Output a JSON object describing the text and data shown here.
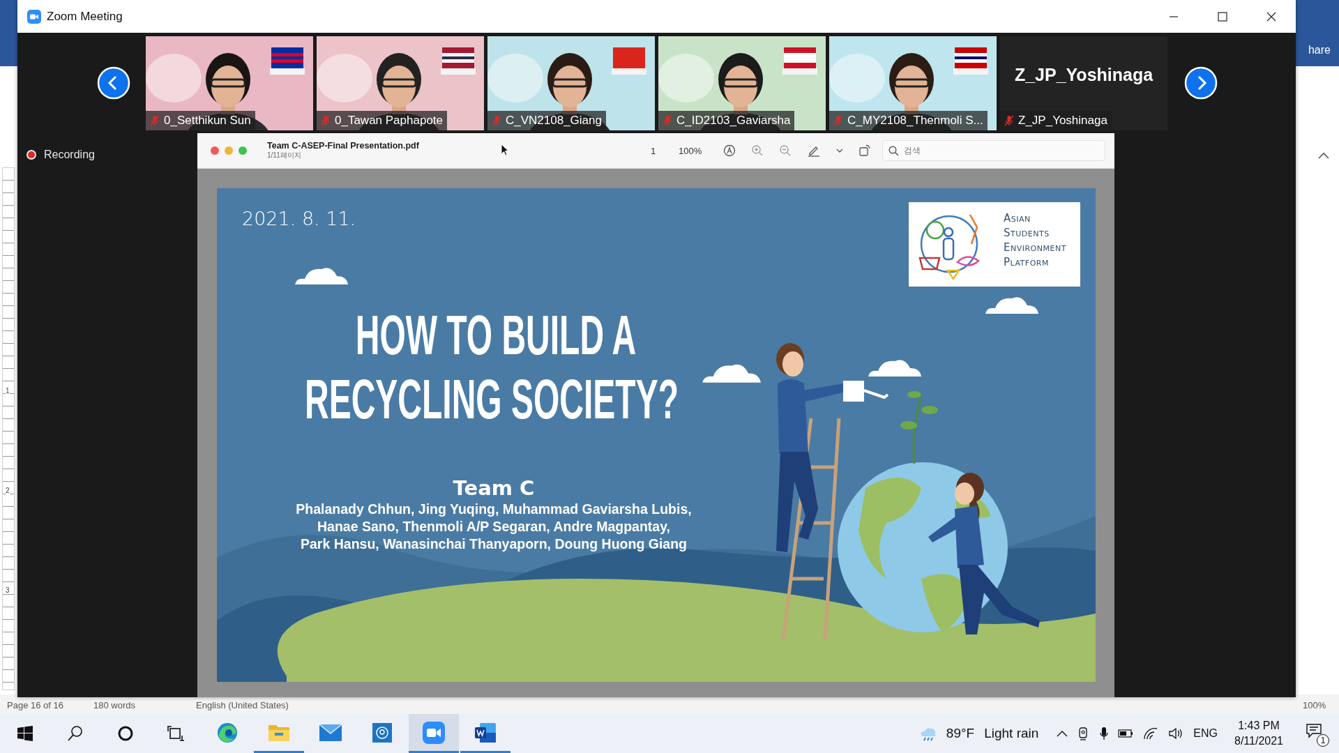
{
  "background_window": {
    "ribbon_text": "hare",
    "ruler_marks": [
      "1",
      "2",
      "3"
    ],
    "status_bar": [
      "Page 16 of 16",
      "180 words",
      "English (United States)",
      "100%"
    ]
  },
  "window": {
    "title": "Zoom Meeting"
  },
  "participants": [
    {
      "kind": "video",
      "name": "0_Setthikun Sun",
      "muted": true
    },
    {
      "kind": "video",
      "name": "0_Tawan Paphapote",
      "muted": true
    },
    {
      "kind": "video",
      "name": "C_VN2108_Giang",
      "muted": true
    },
    {
      "kind": "video",
      "name": "C_ID2103_Gaviarsha",
      "muted": true
    },
    {
      "kind": "video",
      "name": "C_MY2108_Thenmoli S...",
      "muted": true
    },
    {
      "kind": "name",
      "display_name": "Z_JP_Yoshinaga",
      "name": "Z_JP_Yoshinaga",
      "muted": true
    }
  ],
  "recording": {
    "label": "Recording"
  },
  "pdf_viewer": {
    "filename": "Team C-ASEP-Final Presentation.pdf",
    "pages": "1/11페이지",
    "page": "1",
    "zoom": "100%",
    "search_placeholder": "검색"
  },
  "slide": {
    "date": "2021. 8. 11.",
    "logo_lines": [
      "Asian",
      "Students",
      "Environment",
      "Platform"
    ],
    "title_lines": [
      "HOW TO BUILD A",
      "RECYCLING SOCIETY?"
    ],
    "team": "Team C",
    "member_lines": [
      "Phalanady Chhun, Jing Yuqing, Muhammad Gaviarsha Lubis,",
      "Hanae Sano, Thenmoli A/P Segaran, Andre Magpantay,",
      "Park Hansu, Wanasinchai Thanyaporn, Doung Huong Giang"
    ]
  },
  "taskbar": {
    "system_buttons": [
      {
        "kind": "start"
      },
      {
        "kind": "search"
      },
      {
        "kind": "cortana"
      },
      {
        "kind": "taskview"
      }
    ],
    "apps": [
      {
        "kind": "edge",
        "running": false,
        "selected": false
      },
      {
        "kind": "explorer",
        "running": true,
        "selected": false
      },
      {
        "kind": "mail",
        "running": false,
        "selected": false
      },
      {
        "kind": "photos",
        "running": false,
        "selected": false
      },
      {
        "kind": "zoom",
        "running": true,
        "selected": true
      },
      {
        "kind": "word",
        "running": true,
        "selected": false
      }
    ],
    "weather": {
      "temperature": "89°F",
      "condition": "Light rain"
    },
    "language": "ENG",
    "time": "1:43 PM",
    "date": "8/11/2021",
    "notifications": "1"
  }
}
